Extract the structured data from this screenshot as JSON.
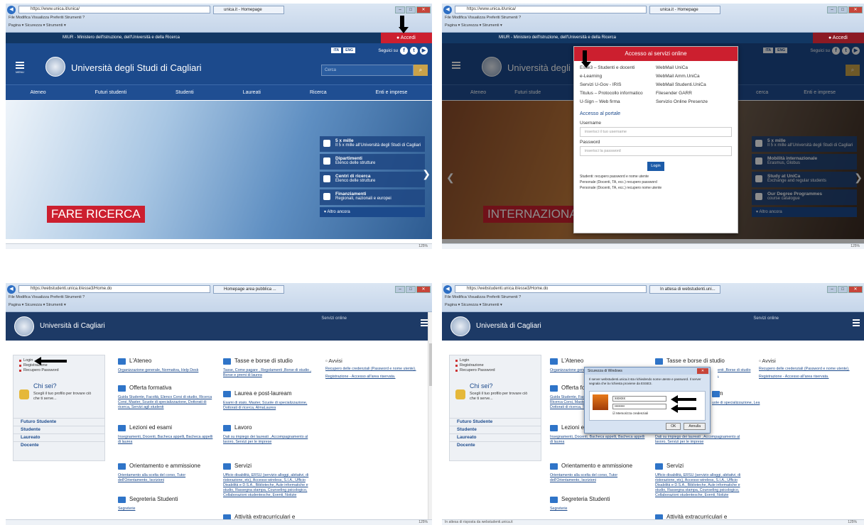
{
  "browser": {
    "menu_items": "File   Modifica   Visualizza   Preferiti   Strumenti   ?",
    "toolbar_items": "Pagina ▾   Sicurezza ▾   Strumenti ▾",
    "zoom": "125%",
    "status_p4": "In attesa di risposta da webstudenti.unica.it"
  },
  "panel1": {
    "url": "https://www.unica.it/unica/",
    "tab": "unica.it - Homepage",
    "ministry": "MIUR - Ministero dell'Istruzione, dell'Università e della Ricerca",
    "accedi": "Accedi",
    "lang_ita": "ITA",
    "lang_eng": "ENG",
    "seguici": "Seguici su",
    "university": "Università degli Studi di Cagliari",
    "menu_label": "MENU",
    "search_placeholder": "Cerca",
    "nav": [
      "Ateneo",
      "Futuri studenti",
      "Studenti",
      "Laureati",
      "Ricerca",
      "Enti e imprese"
    ],
    "hero_tag": "FARE RICERCA",
    "side": [
      {
        "title": "5 x mille",
        "sub": "Il 5 x mille all'Università degli Studi di Cagliari"
      },
      {
        "title": "Dipartimenti",
        "sub": "Elenco delle strutture"
      },
      {
        "title": "Centri di ricerca",
        "sub": "Elenco delle strutture"
      },
      {
        "title": "Finanziamenti",
        "sub": "Regionali, nazionali e europei"
      }
    ],
    "more": "Altro ancora"
  },
  "panel2": {
    "url": "https://www.unica.it/unica/",
    "tab": "unica.it - Homepage",
    "ministry": "MIUR - Ministero dell'Istruzione, dell'Università e della Ricerca",
    "accedi": "Accedi",
    "university": "Università degli S",
    "hero_tag": "INTERNAZIONA",
    "nav": [
      "Ateneo",
      "Futuri stude",
      "cerca",
      "Enti e imprese"
    ],
    "popup_title": "Accesso ai servizi online",
    "services_left": [
      "Esse3 – Studenti e docenti",
      "e-Learning",
      "Servizi U-Gov - IRIS",
      "Titulus – Protocollo informatico",
      "U-Sign – Web firma"
    ],
    "services_right": [
      "WebMail UniCa",
      "WebMail Amm.UniCa",
      "WebMail Studenti.UniCa",
      "Filesender GARR",
      "Servizio Online Presenze"
    ],
    "portal_title": "Accesso al portale",
    "username_label": "Username",
    "username_placeholder": "inserisci il tuo username",
    "password_label": "Password",
    "password_placeholder": "inserisci la password",
    "login_button": "Login",
    "recovery": [
      "Studenti: recupero password e nome utente",
      "Personale (Docenti, TA, ecc.) recupero password",
      "Personale (Docenti, TA, ecc.) recupero nome utente"
    ],
    "side": [
      {
        "title": "5 x mille",
        "sub": "Il 5 x mille all'Università degli Studi di Cagliari"
      },
      {
        "title": "Mobilità internazionale",
        "sub": "Erasmus, Globus"
      },
      {
        "title": "Study at UniCa",
        "sub": "Exchange and regular students"
      },
      {
        "title": "Our Degree Programmes",
        "sub": "course catalogue"
      }
    ],
    "more": "Altro ancora"
  },
  "panel3": {
    "url": "https://webstudenti.unica.it/esse3/Home.do",
    "tab": "Homepage area pubblica ...",
    "university": "Università di Cagliari",
    "servizi": "Servizi online",
    "links": [
      "Login",
      "Registrazione",
      "Recupero Password"
    ],
    "chisei_title": "Chi sei?",
    "chisei_desc": "Scegli il tuo profilo per trovare ciò che ti serve...",
    "roles": [
      "Futuro Studente",
      "Studente",
      "Laureato",
      "Docente"
    ],
    "cats": [
      {
        "title": "L'Ateneo",
        "desc": "Organizzazione generale, Normativa, Help Desk"
      },
      {
        "title": "Tasse e borse di studio",
        "desc": "Tasse, Come pagare , Regolamenti ,Borse di studio , Borse e premi di laurea"
      },
      {
        "title": "Offerta formativa",
        "desc": "Guida Studente, Facoltà, Elenco Corsi di studio, Ricerca Corsi, Master, Scuole di specializzazione, Dottorati di ricerca, Servizi agli studenti"
      },
      {
        "title": "Laurea e post-lauream",
        "desc": "Esami di stato, Master, Scuole di specializzazione, Dottorati di ricerca, AlmaLaurea"
      },
      {
        "title": "Lezioni ed esami",
        "desc": "Insegnamenti, Docenti, Bacheca appelli, Bacheca appelli di laurea"
      },
      {
        "title": "Lavoro",
        "desc": "Dati su impiego dei laureati , Accompagnamento al lavoro, Servizi per le imprese"
      },
      {
        "title": "Orientamento e ammissione",
        "desc": "Orientamento alla scelta del corso, Tutor dell'Orientamento, Iscrizioni"
      },
      {
        "title": "Servizi",
        "desc": "Ufficio disabilità, ERSU (servizio alloggi, abitativi, di ristorazione, etc), Accesso wireless, S.I.A., Ufficio Disabilità e D.S.A., Biblioteche, Aule informatiche e studio, Rassegna stampa, Counseling psicologico, Collaborazioni studentesche, Eventi, Notizie"
      },
      {
        "title": "Segreteria Studenti",
        "desc": "Segreterie"
      },
      {
        "title": "Attività extracurriculari e ricreative",
        "desc": ""
      }
    ],
    "avvisi_title": "Avvisi",
    "avvisi": [
      "Recupero delle credenziali (Password e nome utente).",
      "Registrazione - Accesso all'area riservata."
    ]
  },
  "panel4": {
    "url": "https://webstudenti.unica.it/esse3/Home.do",
    "tab": "In attesa di webstudenti.uni...",
    "dialog_title": "Sicurezza di Windows",
    "dialog_msg": "Il server webstudenti.unica.it sta richiedendo nome utente e password. Il server segnala che la richiesta proviene da ESSE3.",
    "user_value": "xxxxxx",
    "pass_value": "••••••••",
    "remember": "Memorizza credenziali",
    "ok": "OK",
    "annulla": "Annulla",
    "cats_partial": [
      {
        "title": "L'Ateneo",
        "desc": "Organizzazione gene"
      },
      {
        "title": "Offerta for",
        "desc": "Guida Studente, Facc Ricerca Corsi, Maste Dottorati di ricerca, S"
      },
      {
        "title": "Lezioni ed e",
        "desc": "Insegnamenti, Docenti, Bacheca appelli, Bacheca appelli di laurea"
      }
    ],
    "tasse_desc_tail": "enti ,Borse di studio ,",
    "laurea_title": "eam",
    "laurea_desc_tail": "uole di specializzazione, Lea"
  }
}
